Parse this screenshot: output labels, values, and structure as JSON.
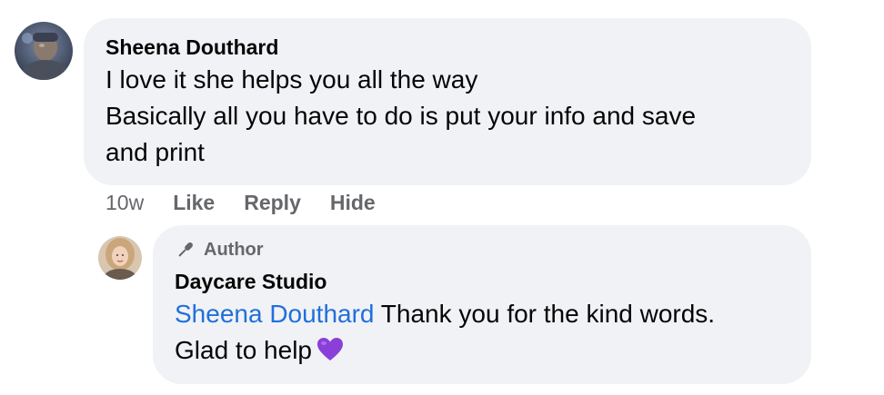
{
  "comment": {
    "author": "Sheena Douthard",
    "lines": [
      "I love it she helps you all the way",
      "Basically all you have to do is put your info and save",
      "and print"
    ],
    "timestamp": "10w",
    "actions": {
      "like": "Like",
      "reply": "Reply",
      "hide": "Hide"
    },
    "avatar_icon": "user-avatar-photo"
  },
  "reply": {
    "badge_label": "Author",
    "badge_icon": "microphone-icon",
    "author": "Daycare Studio",
    "mention": "Sheena Douthard",
    "text_after_mention": " Thank you for the kind words.",
    "line2": "Glad to help",
    "emoji": "purple-heart",
    "avatar_icon": "page-avatar-photo"
  },
  "colors": {
    "bubble_bg": "#f0f2f5",
    "mention": "#216fdb",
    "secondary_text": "#65676b",
    "heart": "#8b3fd9"
  }
}
